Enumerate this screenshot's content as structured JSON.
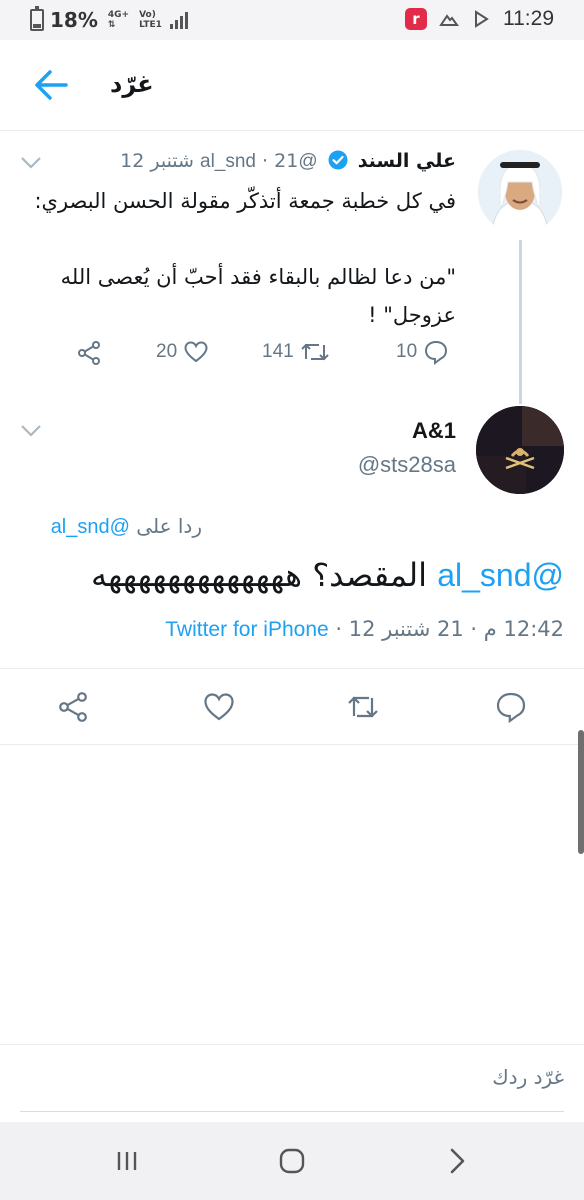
{
  "status_bar": {
    "battery": "18%",
    "network_top": "4G+",
    "network_side": "Vo)",
    "network_bottom": "LTE1",
    "app_badge": "r",
    "time": "11:29"
  },
  "app_bar": {
    "title": "غرّد"
  },
  "tweet_parent": {
    "name": "علي السند",
    "handle": "@al_snd",
    "date": "· 21 شتنبر 12",
    "lines": [
      "في كل خطبة جمعة أتذكّر مقولة الحسن البصري:",
      "",
      "\"من دعا لظالم بالبقاء فقد أحبّ أن يُعصى الله",
      "عزوجل\" !"
    ],
    "replies": "10",
    "retweets": "141",
    "likes": "20"
  },
  "tweet_main": {
    "name": "A&1",
    "handle": "@sts28sa",
    "replying_prefix": "ردا على",
    "replying_handle": "@al_snd",
    "mention": "@al_snd",
    "text": "المقصد؟ هههههههههههههه",
    "time": "12:42 م",
    "date_part": "· 21 شتنبر 12 ·",
    "source": "Twitter for iPhone"
  },
  "composer": {
    "placeholder": "غرّد ردك"
  },
  "colors": {
    "accent": "#1da1f2",
    "secondary_text": "#657786",
    "divider": "#e6ecf0"
  },
  "icons": {
    "back": "arrow-left-icon",
    "verified": "verified-badge-icon",
    "reply": "reply-icon",
    "retweet": "retweet-icon",
    "like": "heart-icon",
    "share": "share-icon",
    "caret": "chevron-down-icon"
  }
}
